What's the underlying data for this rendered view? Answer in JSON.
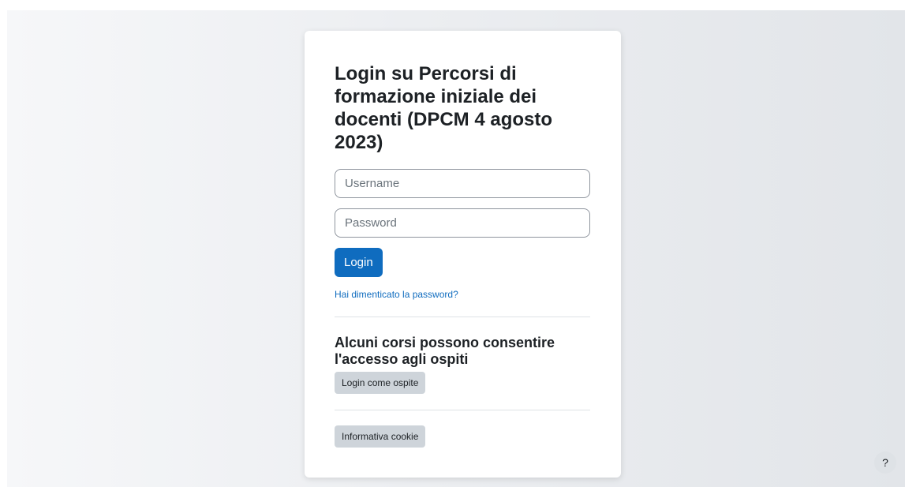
{
  "login": {
    "title": "Login su Percorsi di formazione iniziale dei docenti (DPCM 4 agosto 2023)",
    "username_placeholder": "Username",
    "password_placeholder": "Password",
    "login_button": "Login",
    "forgot_link": "Hai dimenticato la password?"
  },
  "guest": {
    "title": "Alcuni corsi possono consentire l'accesso agli ospiti",
    "button": "Login come ospite"
  },
  "cookie": {
    "button": "Informativa cookie"
  },
  "help": {
    "label": "?",
    "icon": "question-icon"
  },
  "colors": {
    "primary": "#0f6cbf",
    "secondary_button": "#ced4da",
    "text": "#1d2125"
  }
}
